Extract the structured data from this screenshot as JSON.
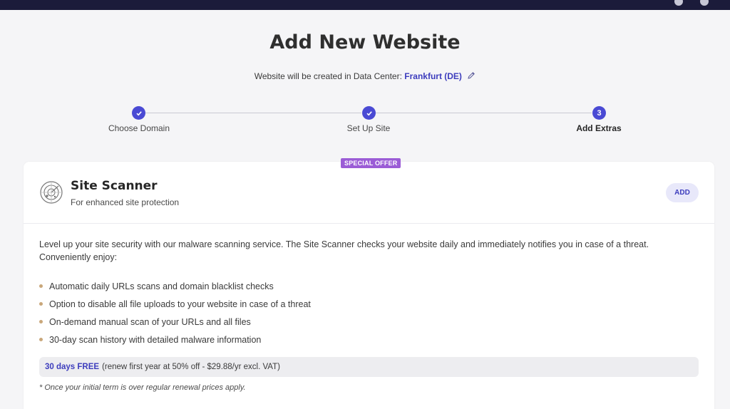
{
  "page": {
    "title": "Add New Website",
    "datacenter_prefix": "Website will be created in Data Center:",
    "datacenter_value": "Frankfurt (DE)"
  },
  "stepper": {
    "steps": [
      {
        "label": "Choose Domain",
        "state": "completed"
      },
      {
        "label": "Set Up Site",
        "state": "completed"
      },
      {
        "label": "Add Extras",
        "state": "active",
        "number": "3"
      }
    ]
  },
  "offer": {
    "badge": "SPECIAL OFFER",
    "title": "Site Scanner",
    "subtitle": "For enhanced site protection",
    "add_label": "ADD",
    "description": "Level up your site security with our malware scanning service. The Site Scanner checks your website daily and immediately notifies you in case of a threat. Conveniently enjoy:",
    "features": [
      "Automatic daily URLs scans and domain blacklist checks",
      "Option to disable all file uploads to your website in case of a threat",
      "On-demand manual scan of your URLs and all files",
      "30-day scan history with detailed malware information"
    ],
    "price_free": "30 days FREE",
    "price_detail": "(renew first year at 50% off - $29.88/yr excl. VAT)",
    "footnote": "* Once your initial term is over regular renewal prices apply."
  },
  "colors": {
    "accent": "#4a4ad4",
    "badge": "#9b5cd6",
    "topbar": "#1b1b3a",
    "background": "#f5f5f7"
  },
  "icons": {
    "edit": "pencil-icon",
    "completed_step": "check-icon",
    "offer": "radar-icon",
    "list_bullet": "bullet-dot-icon"
  }
}
